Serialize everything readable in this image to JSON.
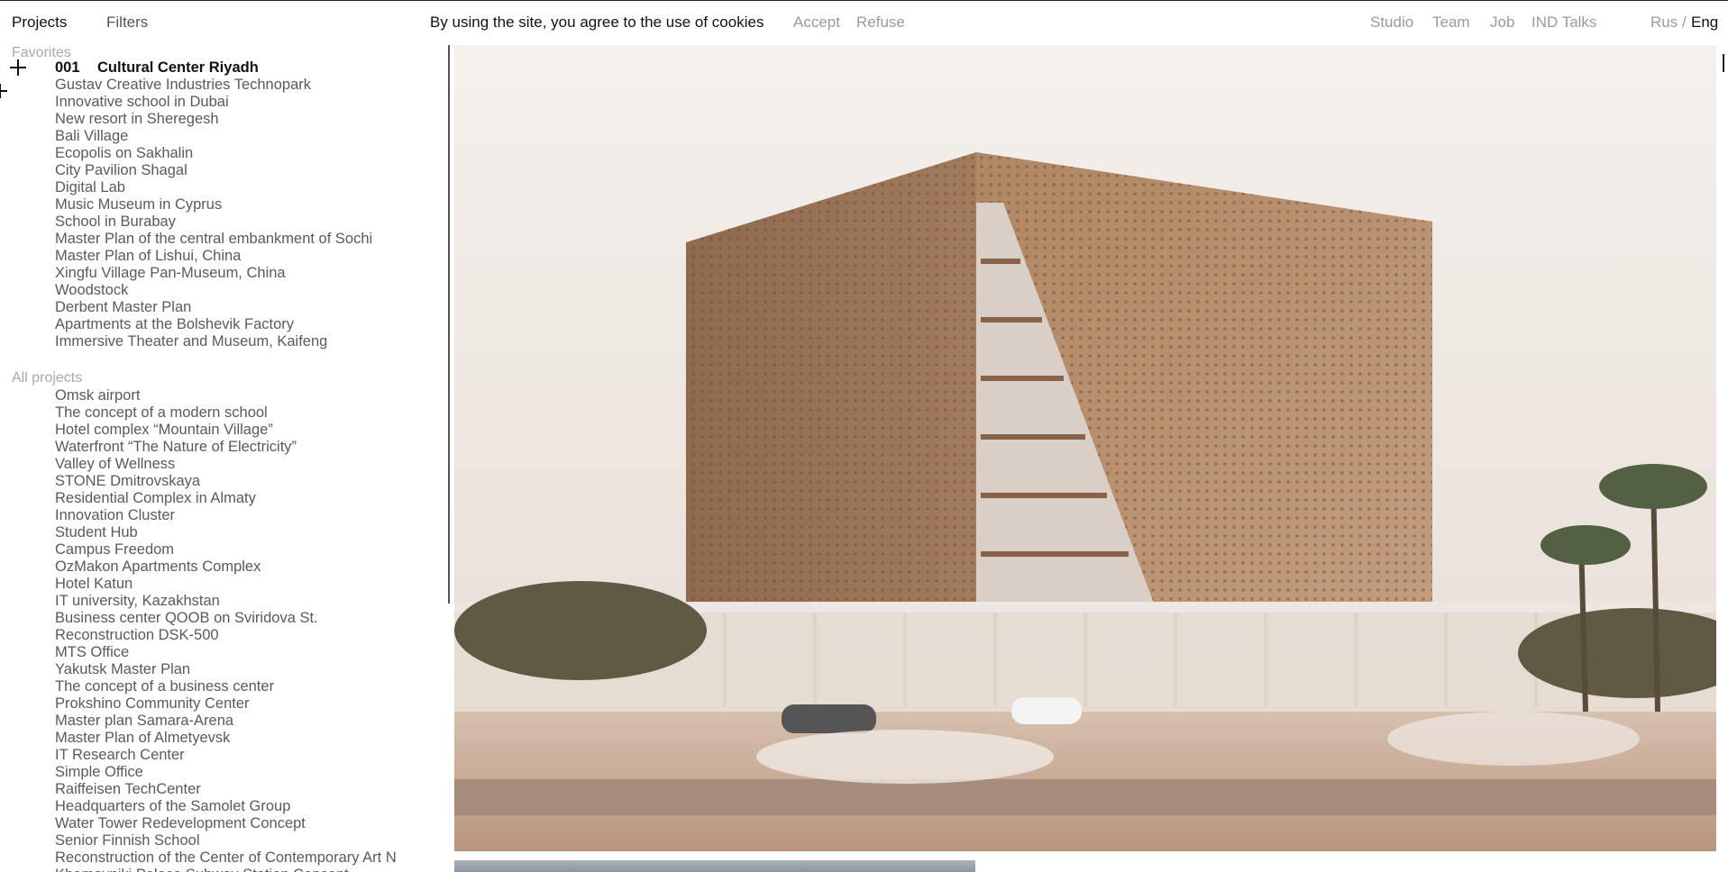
{
  "header": {
    "projects": "Projects",
    "filters": "Filters",
    "cookie_text": "By using the site, you agree to the use of cookies",
    "accept": "Accept",
    "refuse": "Refuse",
    "studio": "Studio",
    "team": "Team",
    "job": "Job",
    "talks": "IND Talks",
    "lang_rus": "Rus",
    "lang_sep": "/",
    "lang_eng": "Eng"
  },
  "sidebar": {
    "favorites_label": "Favorites",
    "active_number": "001",
    "favorites": [
      "Cultural Center Riyadh",
      "Gustav Creative Industries Technopark",
      "Innovative school in Dubai",
      "New resort in Sheregesh",
      "Bali Village",
      "Ecopolis on Sakhalin",
      "City Pavilion Shagal",
      "Digital Lab",
      "Music Museum in Cyprus",
      "School in Burabay",
      "Master Plan of the central embankment of Sochi",
      "Master Plan of Lishui, China",
      "Xingfu Village Pan-Museum, China",
      "Woodstock",
      "Derbent Master Plan",
      "Apartments at the Bolshevik Factory",
      "Immersive Theater and Museum, Kaifeng"
    ],
    "all_label": "All projects",
    "all_projects": [
      "Omsk airport",
      "The concept of a modern school",
      "Hotel complex “Mountain Village”",
      "Waterfront “The Nature of Electricity”",
      "Valley of Wellness",
      "STONE Dmitrovskaya",
      "Residential Complex in Almaty",
      "Innovation Cluster",
      "Student Hub",
      "Campus Freedom",
      "OzMakon Apartments Complex",
      "Hotel Katun",
      "IT university, Kazakhstan",
      "Business center QOOB on Sviridova St.",
      "Reconstruction DSK-500",
      "MTS Office",
      "Yakutsk Master Plan",
      "The concept of a business center",
      "Prokshino Community Center",
      "Master plan Samara-Arena",
      "Master Plan of Almetyevsk",
      "IT Research Center",
      "Simple Office",
      "Raiffeisen TechCenter",
      "Headquarters of the Samolet Group",
      "Water Tower Redevelopment Concept",
      "Senior Finnish School",
      "Reconstruction of the Center of Contemporary Art N",
      "Khamovniki Palace Subway Station Concept"
    ]
  },
  "colors": {
    "text_dark": "#111111",
    "text_muted": "#9a9a9a",
    "list_text": "#5a5a5a",
    "sky": "#efe9e4",
    "facade": "#a97f5e",
    "ground": "#c9ad98"
  }
}
